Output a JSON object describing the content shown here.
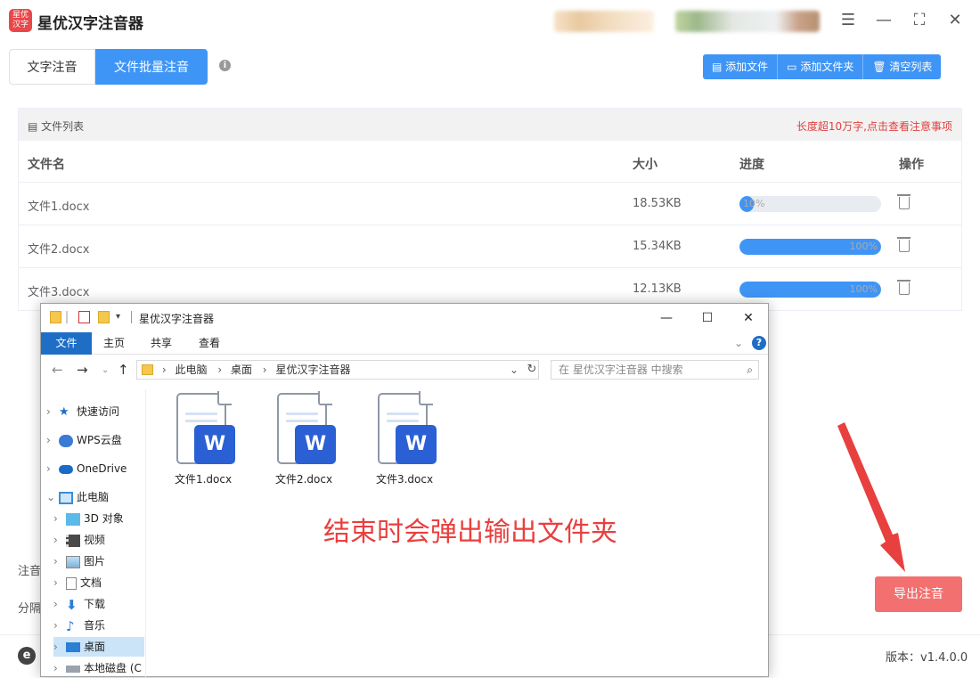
{
  "app": {
    "title": "星优汉字注音器",
    "logo_text": "星优 汉字",
    "version_label": "版本：v1.4.0.0"
  },
  "window_controls": {
    "settings": "☰",
    "minimize": "—",
    "maximize": "⛶",
    "close": "✕"
  },
  "tabs": [
    "文字注音",
    "文件批量注音"
  ],
  "toolbar": {
    "add_file": "添加文件",
    "add_folder": "添加文件夹",
    "clear_list": "清空列表"
  },
  "file_list": {
    "title": "文件列表",
    "note": "长度超10万字,点击查看注意事项",
    "columns": {
      "name": "文件名",
      "size": "大小",
      "progress": "进度",
      "action": "操作"
    },
    "rows": [
      {
        "name": "文件1.docx",
        "size": "18.53KB",
        "progress_label": "10%",
        "progress": 10
      },
      {
        "name": "文件2.docx",
        "size": "15.34KB",
        "progress_label": "100%",
        "progress": 100
      },
      {
        "name": "文件3.docx",
        "size": "12.13KB",
        "progress_label": "100%",
        "progress": 100
      }
    ]
  },
  "side_labels": {
    "pinyin": "注音",
    "separator": "分隔"
  },
  "export_button": "导出注音",
  "explorer": {
    "window_title": "星优汉字注音器",
    "ribbon_tabs": [
      "文件",
      "主页",
      "共享",
      "查看"
    ],
    "breadcrumb": [
      "此电脑",
      "桌面",
      "星优汉字注音器"
    ],
    "search_placeholder": "在 星优汉字注音器 中搜索",
    "nav_items": [
      {
        "label": "快速访问",
        "icon": "star-icon"
      },
      {
        "label": "WPS云盘",
        "icon": "cloud-icon"
      },
      {
        "label": "OneDrive",
        "icon": "onedrive-icon"
      },
      {
        "label": "此电脑",
        "icon": "computer-icon"
      },
      {
        "label": "3D 对象",
        "icon": "cube-icon"
      },
      {
        "label": "视频",
        "icon": "video-icon"
      },
      {
        "label": "图片",
        "icon": "picture-icon"
      },
      {
        "label": "文档",
        "icon": "document-icon"
      },
      {
        "label": "下载",
        "icon": "download-icon"
      },
      {
        "label": "音乐",
        "icon": "music-icon"
      },
      {
        "label": "桌面",
        "icon": "desktop-icon"
      },
      {
        "label": "本地磁盘 (C",
        "icon": "disk-icon"
      }
    ],
    "files": [
      "文件1.docx",
      "文件2.docx",
      "文件3.docx"
    ],
    "file_badge": "W"
  },
  "annotation": "结束时会弹出输出文件夹",
  "colors": {
    "primary": "#3f95f6",
    "export": "#f27070",
    "note_red": "#e0403f",
    "annotation_red": "#e8403f",
    "explorer_blue": "#1e6ec6"
  }
}
